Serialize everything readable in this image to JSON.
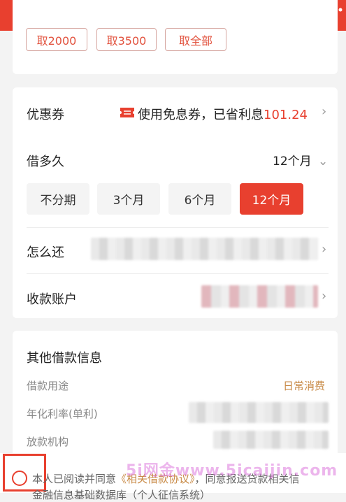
{
  "header": {
    "back_icon": "chevron-left-icon",
    "support_icon": "headset-icon",
    "more_icon": "more-dots-icon"
  },
  "amounts": {
    "options": [
      "取2000",
      "取3500",
      "取全部"
    ]
  },
  "coupon": {
    "label": "优惠券",
    "text": "使用免息券，已省利息",
    "value": "101.24"
  },
  "term": {
    "label": "借多久",
    "selected": "12个月",
    "options": [
      "不分期",
      "3个月",
      "6个月",
      "12个月"
    ],
    "active_index": 3
  },
  "repay": {
    "label": "怎么还"
  },
  "account": {
    "label": "收款账户"
  },
  "info": {
    "title": "其他借款信息",
    "purpose_label": "借款用途",
    "purpose_value": "日常消费",
    "rate_label": "年化利率(单利)",
    "lender_label": "放款机构"
  },
  "agreement": {
    "prefix": "本人已阅读并同意",
    "link": "《相关借款协议》",
    "suffix": "，同意报送贷款相关信",
    "line2": "金融信息基础数据库（个人征信系统）"
  },
  "watermark": "5i网金www.5icaijin.com",
  "colors": {
    "brand": "#e8402f",
    "accent_gold": "#c88a46"
  }
}
